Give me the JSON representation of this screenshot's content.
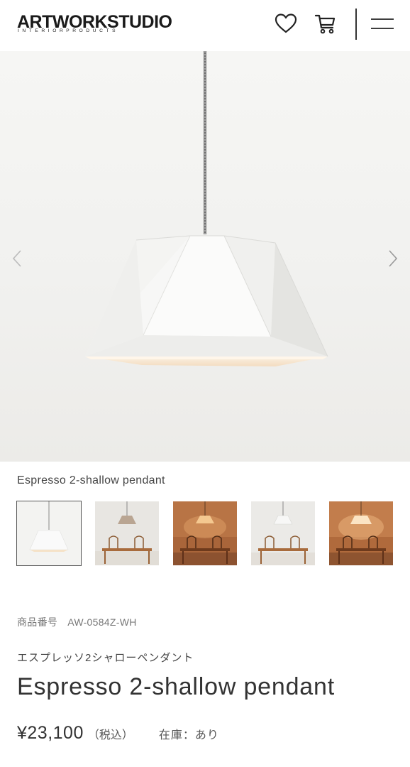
{
  "header": {
    "logo_text": "ARTWORKSTUDIO",
    "logo_subtext": "INTERIORPRODUCTS",
    "icons": [
      "heart-icon",
      "cart-icon",
      "menu-icon"
    ]
  },
  "gallery": {
    "caption": "Espresso 2-shallow pendant",
    "thumbnails": [
      {
        "label": "white shade on plain background",
        "active": true
      },
      {
        "label": "beige shade over dining table",
        "active": false
      },
      {
        "label": "lit shade over dining table",
        "active": false
      },
      {
        "label": "white shade over dining table",
        "active": false
      },
      {
        "label": "lit white shade over dining table",
        "active": false
      }
    ]
  },
  "product": {
    "sku_label": "商品番号",
    "sku_value": "AW-0584Z-WH",
    "name_kana": "エスプレッソ2シャローペンダント",
    "name": "Espresso 2-shallow pendant",
    "price": "¥23,100",
    "tax_note": "（税込）",
    "stock": "在庫：あり"
  },
  "colors": {
    "text": "#333333",
    "muted": "#777777",
    "accent_dark": "#1a1a1a"
  }
}
